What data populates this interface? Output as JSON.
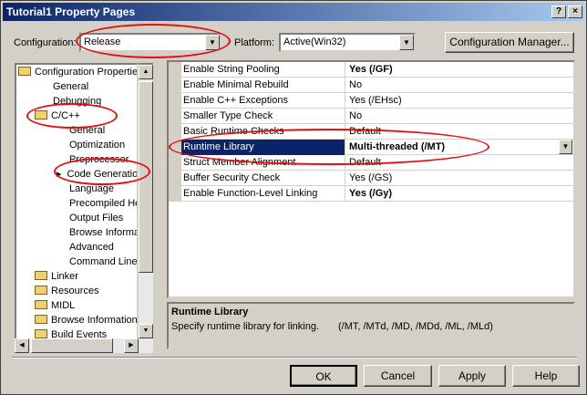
{
  "window": {
    "title": "Tutorial1 Property Pages"
  },
  "top": {
    "config_label": "Configuration:",
    "config_value": "Release",
    "platform_label": "Platform:",
    "platform_value": "Active(Win32)",
    "config_manager_label": "Configuration Manager..."
  },
  "tree": {
    "items": [
      {
        "label": "Configuration Properties",
        "icon": "folder-open-icon"
      },
      {
        "label": "General"
      },
      {
        "label": "Debugging"
      },
      {
        "label": "C/C++",
        "icon": "folder-open-icon"
      },
      {
        "label": "General"
      },
      {
        "label": "Optimization"
      },
      {
        "label": "Preprocessor"
      },
      {
        "label": "Code Generation"
      },
      {
        "label": "Language"
      },
      {
        "label": "Precompiled Hea"
      },
      {
        "label": "Output Files"
      },
      {
        "label": "Browse Informa"
      },
      {
        "label": "Advanced"
      },
      {
        "label": "Command Line"
      },
      {
        "label": "Linker",
        "icon": "folder-icon"
      },
      {
        "label": "Resources",
        "icon": "folder-icon"
      },
      {
        "label": "MIDL",
        "icon": "folder-icon"
      },
      {
        "label": "Browse Information",
        "icon": "folder-icon"
      },
      {
        "label": "Build Events",
        "icon": "folder-icon"
      }
    ]
  },
  "grid": {
    "rows": [
      {
        "name": "Enable String Pooling",
        "value": "Yes (/GF)",
        "bold": true
      },
      {
        "name": "Enable Minimal Rebuild",
        "value": "No",
        "bold": false
      },
      {
        "name": "Enable C++ Exceptions",
        "value": "Yes (/EHsc)",
        "bold": false
      },
      {
        "name": "Smaller Type Check",
        "value": "No",
        "bold": false
      },
      {
        "name": "Basic Runtime Checks",
        "value": "Default",
        "bold": false
      },
      {
        "name": "Runtime Library",
        "value": "Multi-threaded (/MT)",
        "bold": true,
        "selected": true
      },
      {
        "name": "Struct Member Alignment",
        "value": "Default",
        "bold": false
      },
      {
        "name": "Buffer Security Check",
        "value": "Yes (/GS)",
        "bold": false
      },
      {
        "name": "Enable Function-Level Linking",
        "value": "Yes (/Gy)",
        "bold": true
      }
    ]
  },
  "description": {
    "title": "Runtime Library",
    "text": "Specify runtime library for linking.",
    "options": "(/MT, /MTd, /MD, /MDd, /ML, /MLd)"
  },
  "buttons": {
    "ok": "OK",
    "cancel": "Cancel",
    "apply": "Apply",
    "help": "Help"
  },
  "titlebar_buttons": {
    "help": "?",
    "close": "×"
  },
  "icons": {
    "combo_arrow": "▼",
    "scroll_up": "▲",
    "scroll_down": "▼",
    "scroll_left": "◀",
    "scroll_right": "▶",
    "tree_pointer": "▸"
  },
  "colors": {
    "selection": "#0a246a",
    "annotation": "#e01010",
    "title_gradient_start": "#0a246a"
  }
}
